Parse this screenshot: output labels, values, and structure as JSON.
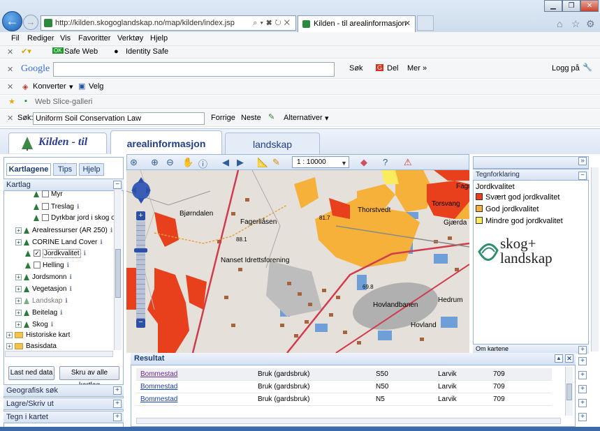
{
  "browser": {
    "url": "http://kilden.skogoglandskap.no/map/kilden/index.jsp",
    "tab_title": "Kilden - til arealinformasjon",
    "menu": [
      "Fil",
      "Rediger",
      "Vis",
      "Favoritter",
      "Verktøy",
      "Hjelp"
    ],
    "toolbar1": {
      "safe_web": "Safe Web",
      "identity_safe": "Identity Safe"
    },
    "google": {
      "logo": "Google",
      "sok": "Søk",
      "del": "Del",
      "mer": "Mer »",
      "logg_pa": "Logg på"
    },
    "toolbar3": {
      "konverter": "Konverter",
      "velg": "Velg"
    },
    "web_slice": "Web Slice-galleri",
    "findbar": {
      "label": "Søk:",
      "value": "Uniform Soil Conservation Law",
      "prev": "Forrige",
      "next": "Neste",
      "alternativer": "Alternativer"
    }
  },
  "app": {
    "logo_text": "Kilden - til",
    "tabs": [
      "arealinformasjon",
      "landskap"
    ],
    "scale": "1 : 10000"
  },
  "left_panel": {
    "tabs": [
      "Kartlagene",
      "Tips",
      "Hjelp"
    ],
    "kartlag_title": "Kartlag",
    "tree": [
      "Myr",
      "Treslag",
      "Dyrkbar jord i skog o",
      "Arealressurser (AR 250)",
      "CORINE Land Cover",
      "Jordkvalitet",
      "Helling",
      "Jordsmonn",
      "Vegetasjon",
      "Landskap",
      "Beitelag",
      "Skog",
      "Historiske kart",
      "Basisdata"
    ],
    "buttons": [
      "Last ned data",
      "Skru av alle kartlag"
    ],
    "sections": [
      "Geografisk søk",
      "Lagre/Skriv ut",
      "Tegn i kartet"
    ]
  },
  "map_labels": [
    "Bjørndalen",
    "Fagerliåsen",
    "Thorstvedt",
    "Torsvang",
    "Nanset Idrettsforening",
    "Hovlandbanen",
    "Hedrum",
    "Hovland",
    "Gjærda",
    "Fagr",
    "88.1",
    "81.7",
    "69.8"
  ],
  "legend": {
    "title": "Tegnforklaring",
    "subtitle": "Jordkvalitet",
    "items": [
      {
        "label": "Svært god jordkvalitet",
        "color": "#e8401c"
      },
      {
        "label": "God jordkvalitet",
        "color": "#f6b13a"
      },
      {
        "label": "Mindre god jordkvalitet",
        "color": "#fbec5d"
      }
    ],
    "logo": "skog+ landskap",
    "om_kartene": "Om kartene"
  },
  "result": {
    "title": "Resultat",
    "rows": [
      [
        "Bommestad",
        "Bruk (gardsbruk)",
        "S50",
        "Larvik",
        "709"
      ],
      [
        "Bommestad",
        "Bruk (gardsbruk)",
        "N50",
        "Larvik",
        "709"
      ],
      [
        "Bommestad",
        "Bruk (gardsbruk)",
        "N5",
        "Larvik",
        "709"
      ]
    ]
  }
}
